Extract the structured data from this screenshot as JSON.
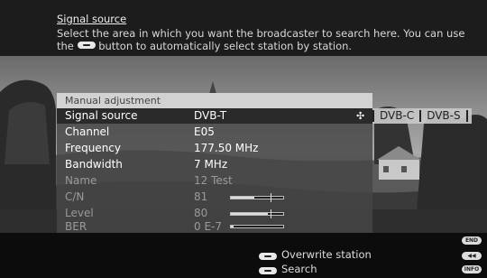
{
  "help": {
    "title": "Signal source",
    "text_before": "Select the area in which you want the broadcaster to search here. You can use the",
    "text_after": "button to automatically select station by station."
  },
  "panel": {
    "title": "Manual adjustment",
    "rows": [
      {
        "label": "Signal source",
        "value": "DVB-T",
        "selected": true
      },
      {
        "label": "Channel",
        "value": "E05"
      },
      {
        "label": "Frequency",
        "value": "177.50 MHz"
      },
      {
        "label": "Bandwidth",
        "value": "7 MHz"
      },
      {
        "label": "Name",
        "value": "12 Test"
      },
      {
        "label": "C/N",
        "value": "81",
        "meter": 0.45
      },
      {
        "label": "Level",
        "value": "80",
        "meter": 0.7
      },
      {
        "label": "BER",
        "value": "0 E-7",
        "meter": 0.05
      }
    ]
  },
  "source_options": [
    "DVB-C",
    "DVB-S"
  ],
  "bottom": {
    "end_label": "END",
    "rewind_label": "◀◀",
    "info_label": "INFO",
    "overwrite_label": "Overwrite station",
    "search_label": "Search"
  },
  "colors": {
    "panel_bg": "#464646",
    "title_bar": "#d2d2d2",
    "selected_row": "#2a2a2a"
  }
}
